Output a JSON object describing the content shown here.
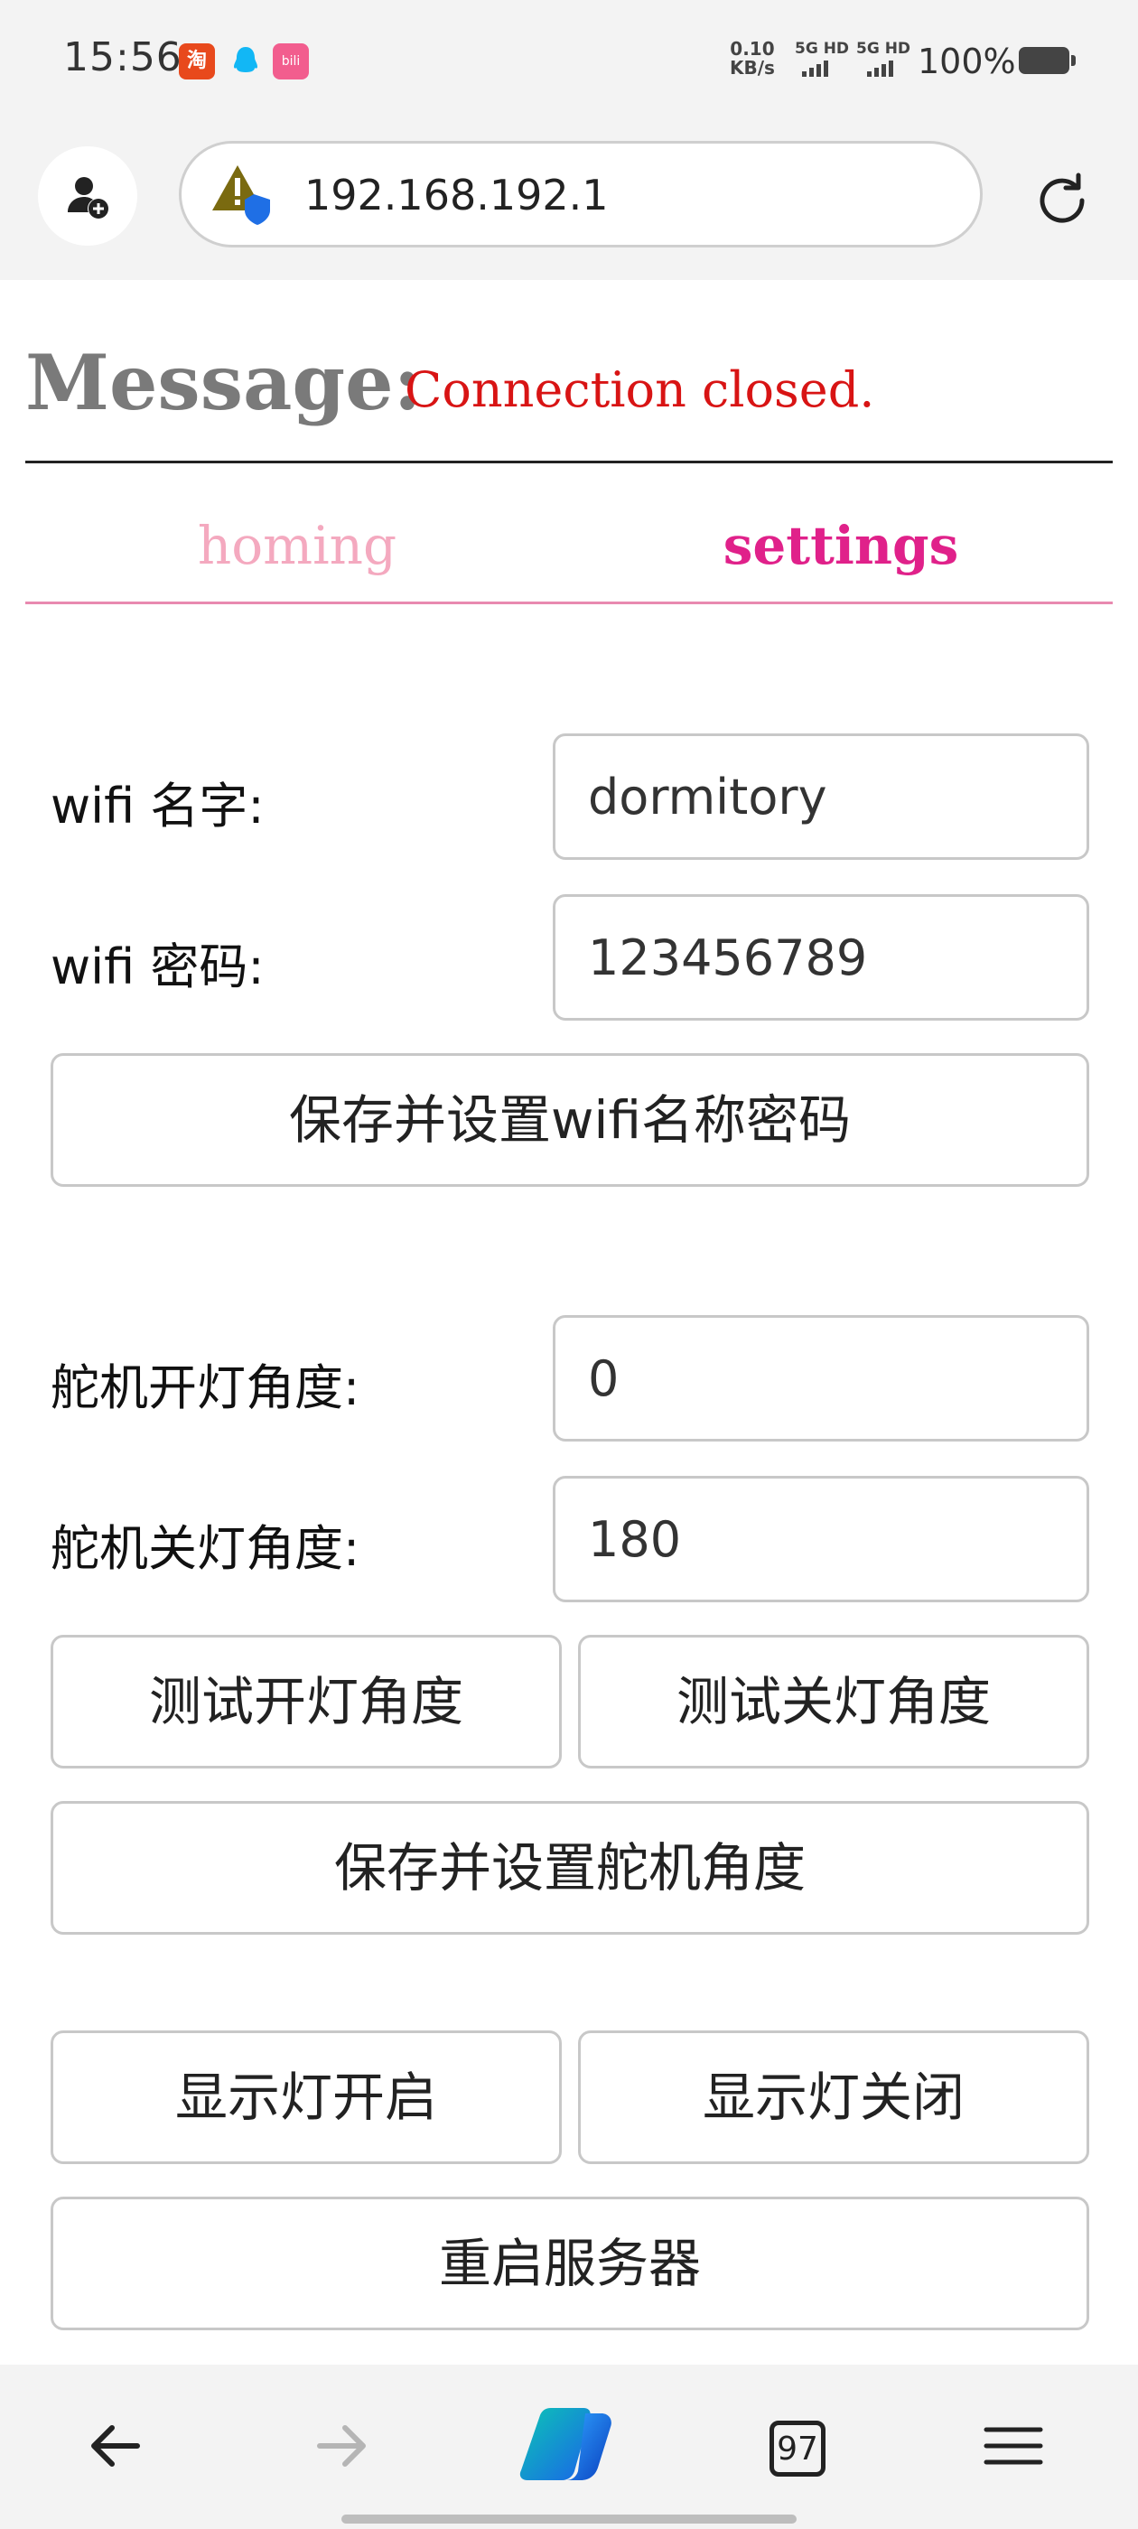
{
  "status_bar": {
    "time": "15:56",
    "net_speed_value": "0.10",
    "net_speed_unit": "KB/s",
    "signal_1": "5G HD",
    "signal_2": "5G HD",
    "battery": "100%",
    "apps": [
      "taobao-icon",
      "qq-icon",
      "bilibili-icon"
    ]
  },
  "browser": {
    "url": "192.168.192.1",
    "icons": {
      "profile": "add-profile-icon",
      "security": "not-secure-warning-icon",
      "reload": "reload-icon"
    }
  },
  "page": {
    "message_label": "Message:",
    "message_value": "Connection closed.",
    "tabs": [
      {
        "label": "homing",
        "active": false
      },
      {
        "label": "settings",
        "active": true
      }
    ],
    "wifi": {
      "name_label": "wifi 名字:",
      "name_value": "dormitory",
      "password_label": "wifi 密码:",
      "password_value": "123456789",
      "save_button": "保存并设置wifi名称密码"
    },
    "servo": {
      "on_angle_label": "舵机开灯角度:",
      "on_angle_value": "0",
      "off_angle_label": "舵机关灯角度:",
      "off_angle_value": "180",
      "test_on_button": "测试开灯角度",
      "test_off_button": "测试关灯角度",
      "save_button": "保存并设置舵机角度"
    },
    "indicator": {
      "on_button": "显示灯开启",
      "off_button": "显示灯关闭"
    },
    "restart_button": "重启服务器"
  },
  "bottom_nav": {
    "tab_count": "97",
    "icons": [
      "back-arrow-icon",
      "forward-arrow-icon",
      "copilot-icon",
      "tabs-icon",
      "menu-icon"
    ]
  },
  "colors": {
    "message_label": "#7a7a7a",
    "message_value": "#d81414",
    "tab_active": "#e0218a",
    "tab_inactive": "#f4a9bf",
    "tab_rule": "#e88ab0"
  }
}
